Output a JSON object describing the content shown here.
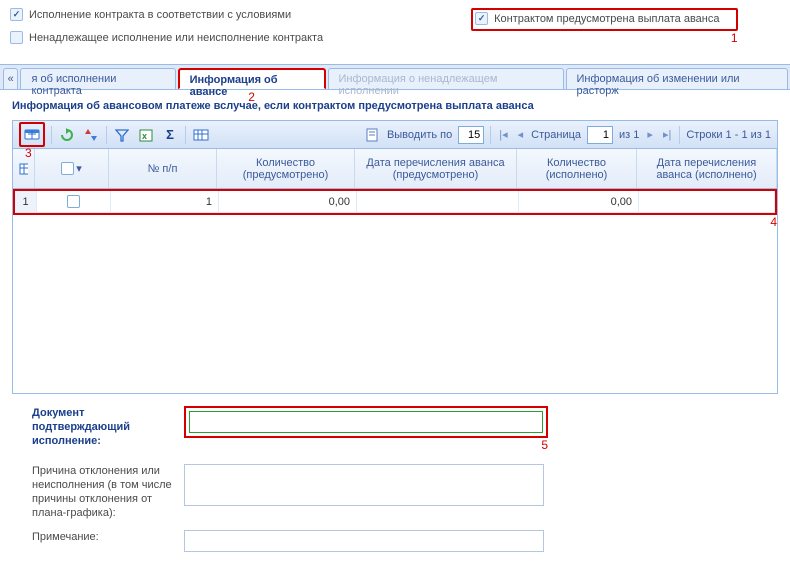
{
  "checkboxes": {
    "compliance": {
      "label": "Исполнение контракта в соответствии с условиями",
      "checked": true
    },
    "advance": {
      "label": "Контрактом предусмотрена выплата аванса",
      "checked": true
    },
    "improper": {
      "label": "Ненадлежащее исполнение или неисполнение контракта",
      "checked": false
    }
  },
  "annotations": {
    "a1": "1",
    "a2": "2",
    "a3": "3",
    "a4": "4",
    "a5": "5"
  },
  "tabs": {
    "scroll_left": "«",
    "t0": "я об исполнении контракта",
    "t1": "Информация об авансе",
    "t2": "Информация о ненадлежащем исполнении",
    "t3": "Информация об изменении или расторж"
  },
  "subheader": "Информация об авансовом платеже вслучае, если контрактом предусмотрена выплата аванса",
  "toolbar": {
    "export_label": "",
    "output_by": "Выводить по",
    "page_size": "15",
    "page_label": "Страница",
    "page_num": "1",
    "of": "из 1",
    "rows_summary": "Строки 1 - 1 из 1"
  },
  "grid": {
    "headers": {
      "np": "№ п/п",
      "q1": "Количество (предусмотрено)",
      "d1": "Дата перечисления аванса (предусмотрено)",
      "q2": "Количество (исполнено)",
      "d2": "Дата перечисления аванса (исполнено)"
    },
    "row": {
      "idx": "1",
      "np": "1",
      "q1": "0,00",
      "d1": "",
      "q2": "0,00",
      "d2": ""
    }
  },
  "form": {
    "doc_label": "Документ подтверждающий исполнение:",
    "doc_value": "",
    "reason_label": "Причина отклонения или неисполнения (в том числе причины отклонения от плана-графика):",
    "reason_value": "",
    "note_label": "Примечание:",
    "note_value": ""
  }
}
